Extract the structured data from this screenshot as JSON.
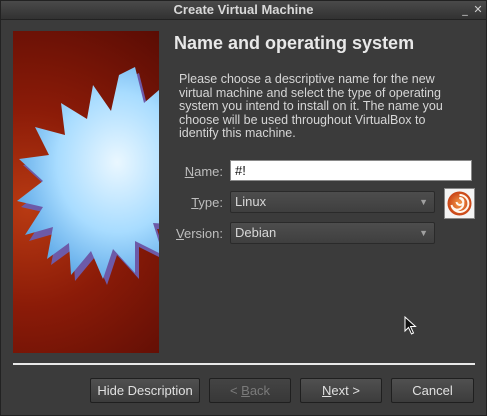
{
  "window": {
    "title": "Create Virtual Machine",
    "minimize_glyph": "_",
    "close_glyph": "✕"
  },
  "page": {
    "heading": "Name and operating system",
    "description": "Please choose a descriptive name for the new virtual machine and select the type of operating system you intend to install on it. The name you choose will be used throughout VirtualBox to identify this machine."
  },
  "form": {
    "name_label_mnemonic": "N",
    "name_label_rest": "ame:",
    "name_value": "#!",
    "type_label_mnemonic": "T",
    "type_label_rest": "ype:",
    "type_value": "Linux",
    "version_label_mnemonic": "V",
    "version_label_rest": "ersion:",
    "version_value": "Debian",
    "os_icon": "debian-swirl-icon"
  },
  "buttons": {
    "hide_description": "Hide Description",
    "back_prefix": "< ",
    "back_mnemonic": "B",
    "back_rest": "ack",
    "next_mnemonic": "N",
    "next_rest": "ext >",
    "cancel": "Cancel"
  },
  "colors": {
    "window_bg": "#3b3b3b",
    "banner_red": "#8b1b08",
    "star_blue": "#a8dcff"
  }
}
